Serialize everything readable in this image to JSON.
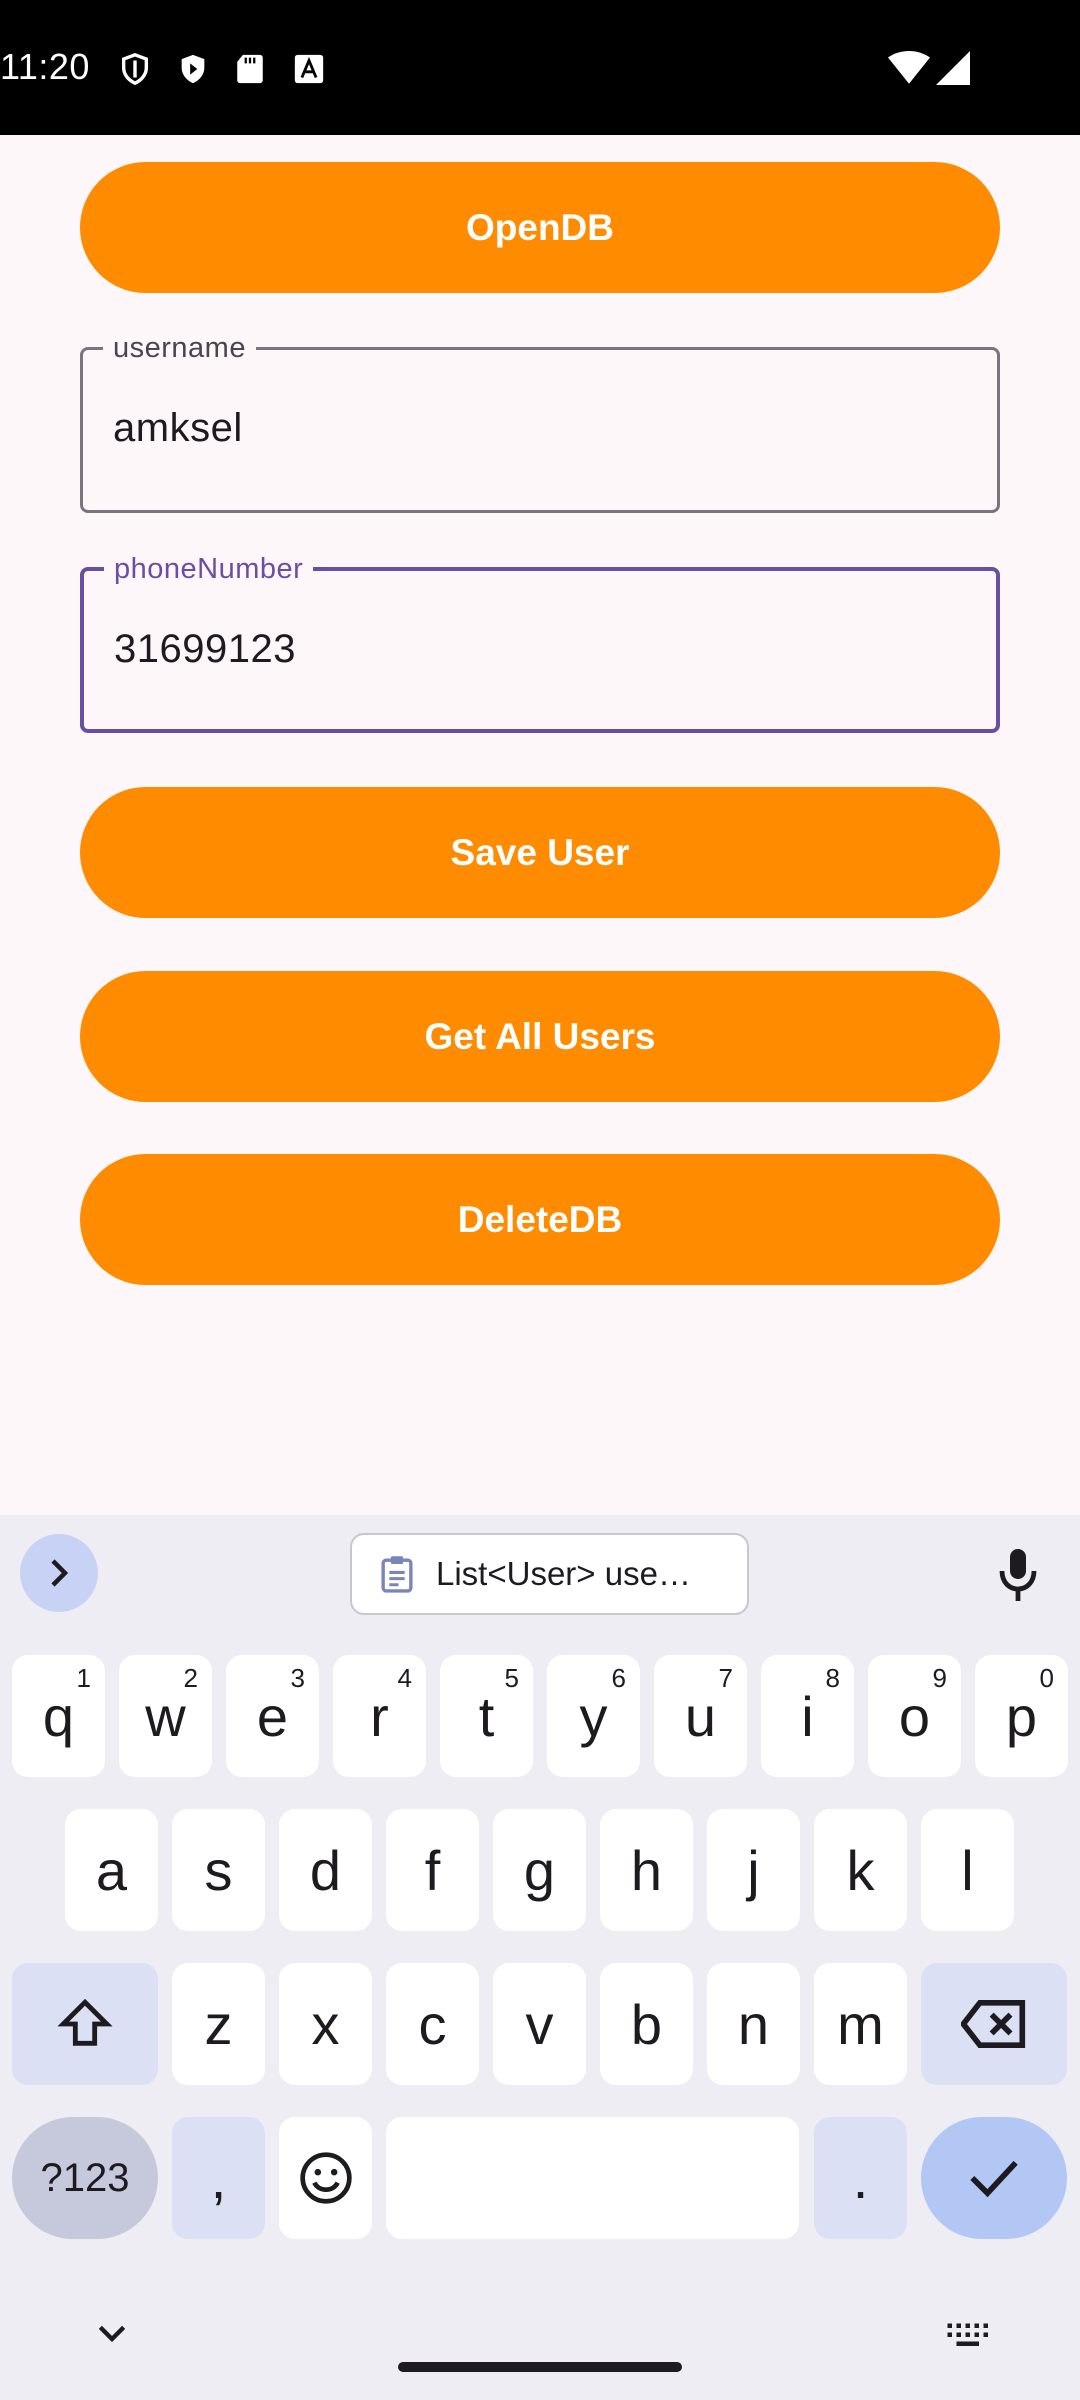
{
  "status_bar": {
    "time": "11:20",
    "icons": [
      "shield-icon",
      "play-icon",
      "sd-card-icon",
      "font-icon",
      "wifi-icon",
      "signal-icon"
    ]
  },
  "app": {
    "buttons": {
      "open_db": "OpenDB",
      "save_user": "Save User",
      "get_all_users": "Get All Users",
      "delete_db": "DeleteDB"
    },
    "username_field": {
      "label": "username",
      "value": "amksel"
    },
    "phone_field": {
      "label": "phoneNumber",
      "value": "31699123"
    },
    "colors": {
      "button": "#ff8c00",
      "focus": "#6750a4"
    }
  },
  "keyboard": {
    "clipboard_suggestion": "List<User> use…",
    "row1": [
      {
        "k": "q",
        "h": "1"
      },
      {
        "k": "w",
        "h": "2"
      },
      {
        "k": "e",
        "h": "3"
      },
      {
        "k": "r",
        "h": "4"
      },
      {
        "k": "t",
        "h": "5"
      },
      {
        "k": "y",
        "h": "6"
      },
      {
        "k": "u",
        "h": "7"
      },
      {
        "k": "i",
        "h": "8"
      },
      {
        "k": "o",
        "h": "9"
      },
      {
        "k": "p",
        "h": "0"
      }
    ],
    "row2": [
      "a",
      "s",
      "d",
      "f",
      "g",
      "h",
      "j",
      "k",
      "l"
    ],
    "row3": [
      "z",
      "x",
      "c",
      "v",
      "b",
      "n",
      "m"
    ],
    "symbols_label": "?123",
    "comma": ",",
    "period": "."
  }
}
